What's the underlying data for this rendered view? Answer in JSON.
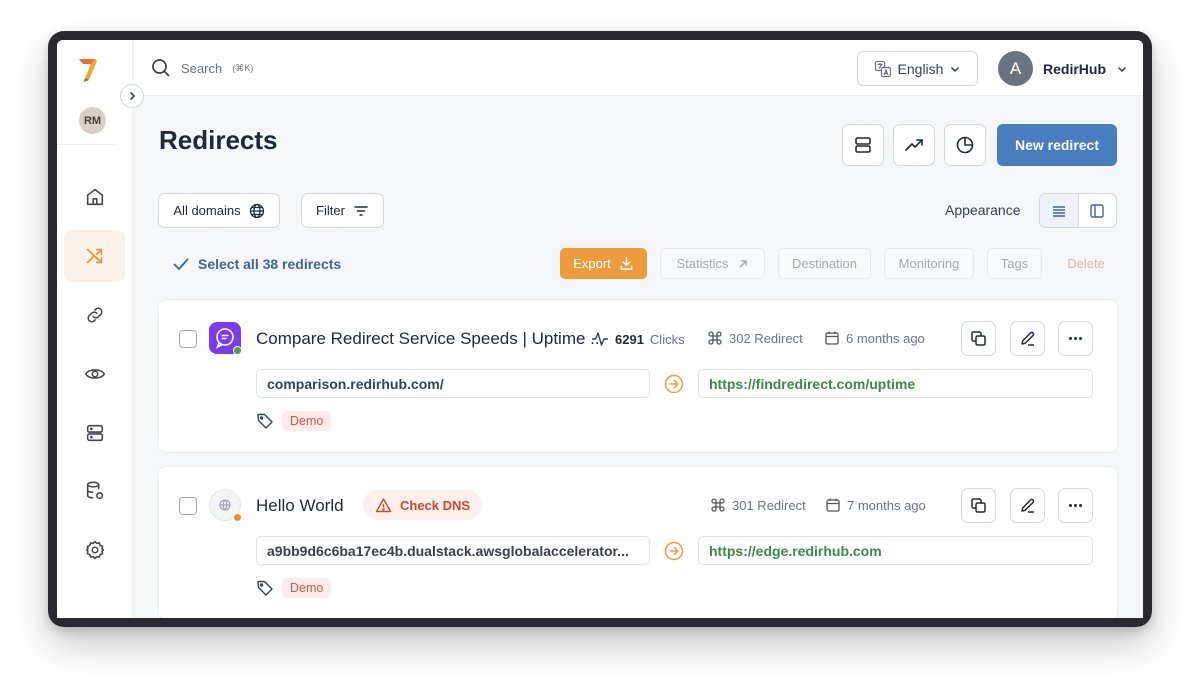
{
  "sidebar": {
    "user_initials": "RM",
    "items": [
      {
        "icon": "home-icon"
      },
      {
        "icon": "shuffle-icon",
        "active": true
      },
      {
        "icon": "link-icon"
      },
      {
        "icon": "eye-icon"
      },
      {
        "icon": "server-icon"
      },
      {
        "icon": "database-settings-icon"
      },
      {
        "icon": "gear-icon"
      }
    ]
  },
  "topbar": {
    "search_placeholder": "Search",
    "search_shortcut": "(⌘K)",
    "language": "English",
    "user_initial": "A",
    "user_name": "RedirHub"
  },
  "header": {
    "title": "Redirects",
    "new_redirect_label": "New redirect"
  },
  "filters": {
    "domains_label": "All domains",
    "filter_label": "Filter",
    "appearance_label": "Appearance"
  },
  "bulk": {
    "select_all_label": "Select all 38 redirects",
    "export_label": "Export",
    "statistics_label": "Statistics",
    "destination_label": "Destination",
    "monitoring_label": "Monitoring",
    "tags_label": "Tags",
    "delete_label": "Delete"
  },
  "redirects": [
    {
      "title": "Compare Redirect Service Speeds | Uptime ...",
      "clicks_count": "6291",
      "clicks_label": "Clicks",
      "type": "302 Redirect",
      "age": "6 months ago",
      "source": "comparison.redirhub.com/",
      "destination": "https://findredirect.com/uptime",
      "tag": "Demo",
      "status_color": "#3fa34d"
    },
    {
      "title": "Hello World",
      "badge": "Check DNS",
      "type": "301 Redirect",
      "age": "7 months ago",
      "source": "a9bb9d6c6ba17ec4b.dualstack.awsglobalaccelerator...",
      "destination": "https://edge.redirhub.com",
      "tag": "Demo",
      "status_color": "#ef8a2c"
    }
  ],
  "colors": {
    "accent": "#4a7dbe",
    "export": "#ed9b3c",
    "destination_text": "#3a8a46",
    "tag_text": "#d9553e"
  }
}
